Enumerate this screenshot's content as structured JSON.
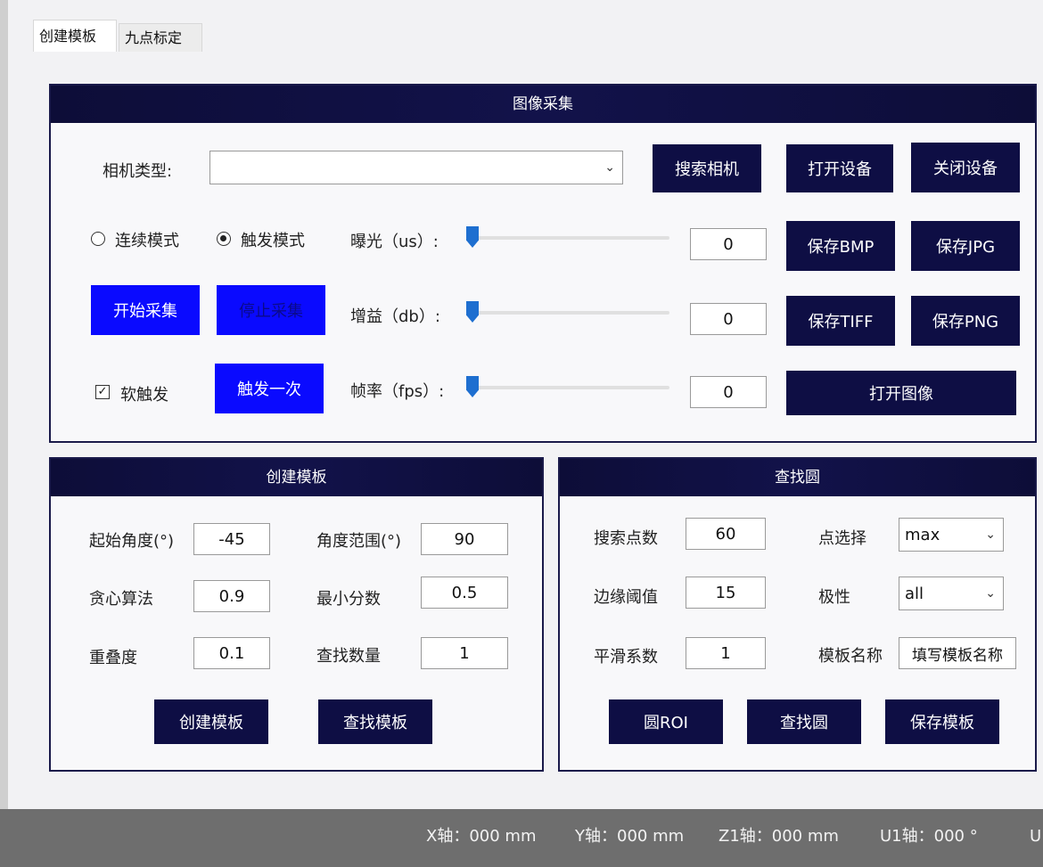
{
  "tabs": [
    {
      "label": "创建模板"
    },
    {
      "label": "九点标定"
    }
  ],
  "capture": {
    "title": "图像采集",
    "camera_type_label": "相机类型:",
    "camera_type_value": "",
    "search_camera": "搜索相机",
    "open_device": "打开设备",
    "close_device": "关闭设备",
    "continuous_mode": "连续模式",
    "trigger_mode": "触发模式",
    "start_capture": "开始采集",
    "stop_capture": "停止采集",
    "soft_trigger": "软触发",
    "trigger_once": "触发一次",
    "exposure_label": "曝光（us）:",
    "exposure_value": "0",
    "gain_label": "增益（db）:",
    "gain_value": "0",
    "framerate_label": "帧率（fps）:",
    "framerate_value": "0",
    "save_bmp": "保存BMP",
    "save_jpg": "保存JPG",
    "save_tiff": "保存TIFF",
    "save_png": "保存PNG",
    "open_image": "打开图像"
  },
  "template": {
    "title": "创建模板",
    "start_angle_label": "起始角度(°)",
    "start_angle_value": "-45",
    "angle_range_label": "角度范围(°)",
    "angle_range_value": "90",
    "greedy_label": "贪心算法",
    "greedy_value": "0.9",
    "min_score_label": "最小分数",
    "min_score_value": "0.5",
    "overlap_label": "重叠度",
    "overlap_value": "0.1",
    "find_count_label": "查找数量",
    "find_count_value": "1",
    "create_template": "创建模板",
    "find_template": "查找模板"
  },
  "circle": {
    "title": "查找圆",
    "search_points_label": "搜索点数",
    "search_points_value": "60",
    "point_select_label": "点选择",
    "point_select_value": "max",
    "edge_threshold_label": "边缘阈值",
    "edge_threshold_value": "15",
    "polarity_label": "极性",
    "polarity_value": "all",
    "smooth_label": "平滑系数",
    "smooth_value": "1",
    "template_name_label": "模板名称",
    "template_name_value": "填写模板名称",
    "circle_roi": "圆ROI",
    "find_circle": "查找圆",
    "save_template": "保存模板"
  },
  "status": {
    "x_axis": "X轴：000 mm",
    "y_axis": "Y轴：000 mm",
    "z1_axis": "Z1轴：000 mm",
    "u1_axis": "U1轴：000 °",
    "u_partial": "U"
  },
  "colors": {
    "panel_header": "#0d0d38",
    "dark_button": "#0e0e44",
    "blue_button": "#0a0aff",
    "slider_thumb": "#1e6fd0",
    "status_bar": "#6e6e6e"
  }
}
